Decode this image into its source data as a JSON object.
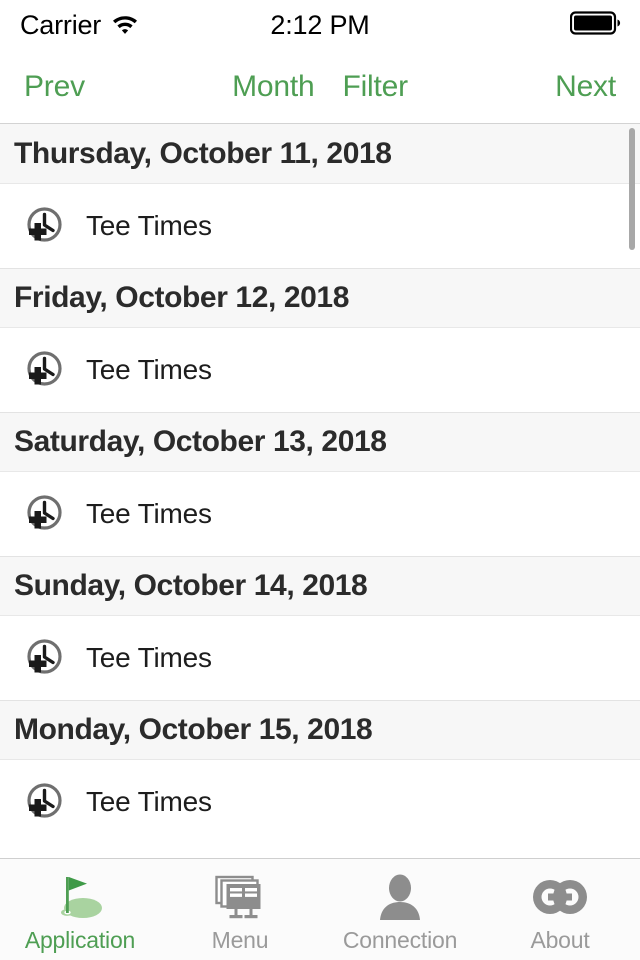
{
  "status_bar": {
    "carrier": "Carrier",
    "wifi_icon": "wifi-icon",
    "time": "2:12 PM",
    "battery_icon": "battery-full-icon"
  },
  "nav_bar": {
    "prev_label": "Prev",
    "month_label": "Month",
    "filter_label": "Filter",
    "next_label": "Next",
    "tint_color": "#4E9E53"
  },
  "list": {
    "row_icon": "clock-add-icon",
    "sections": [
      {
        "date": "Thursday, October 11, 2018",
        "rows": [
          {
            "label": "Tee Times"
          }
        ]
      },
      {
        "date": "Friday, October 12, 2018",
        "rows": [
          {
            "label": "Tee Times"
          }
        ]
      },
      {
        "date": "Saturday, October 13, 2018",
        "rows": [
          {
            "label": "Tee Times"
          }
        ]
      },
      {
        "date": "Sunday, October 14, 2018",
        "rows": [
          {
            "label": "Tee Times"
          }
        ]
      },
      {
        "date": "Monday, October 15, 2018",
        "rows": [
          {
            "label": "Tee Times"
          }
        ]
      }
    ]
  },
  "tab_bar": {
    "active_index": 0,
    "active_color": "#4E9E53",
    "inactive_color": "#9a9a9a",
    "items": [
      {
        "label": "Application",
        "icon": "golf-flag-green-icon"
      },
      {
        "label": "Menu",
        "icon": "menu-boards-icon"
      },
      {
        "label": "Connection",
        "icon": "person-icon"
      },
      {
        "label": "About",
        "icon": "double-g-logo-icon"
      }
    ]
  }
}
